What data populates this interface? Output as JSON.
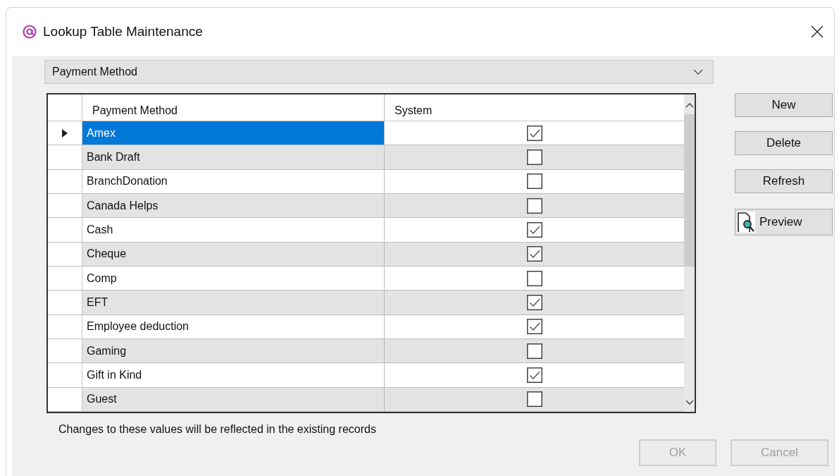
{
  "window": {
    "title": "Lookup Table Maintenance"
  },
  "table_select": {
    "value": "Payment Method"
  },
  "grid": {
    "columns": [
      "Payment Method",
      "System"
    ],
    "rows": [
      {
        "name": "Amex",
        "system": true,
        "selected": true
      },
      {
        "name": "Bank Draft",
        "system": false,
        "selected": false
      },
      {
        "name": "BranchDonation",
        "system": false,
        "selected": false
      },
      {
        "name": "Canada Helps",
        "system": false,
        "selected": false
      },
      {
        "name": "Cash",
        "system": true,
        "selected": false
      },
      {
        "name": "Cheque",
        "system": true,
        "selected": false
      },
      {
        "name": "Comp",
        "system": false,
        "selected": false
      },
      {
        "name": "EFT",
        "system": true,
        "selected": false
      },
      {
        "name": "Employee deduction",
        "system": true,
        "selected": false
      },
      {
        "name": "Gaming",
        "system": false,
        "selected": false
      },
      {
        "name": "Gift in Kind",
        "system": true,
        "selected": false
      },
      {
        "name": "Guest",
        "system": false,
        "selected": false
      }
    ]
  },
  "side_buttons": [
    {
      "label": "New",
      "kind": "plain"
    },
    {
      "label": "Delete",
      "kind": "plain"
    },
    {
      "label": "Refresh",
      "kind": "plain"
    },
    {
      "label": "Preview",
      "kind": "preview"
    }
  ],
  "note": "Changes to these values will be reflected in the existing records",
  "footer_buttons": [
    {
      "label": "OK",
      "disabled": true
    },
    {
      "label": "Cancel",
      "disabled": true
    }
  ]
}
